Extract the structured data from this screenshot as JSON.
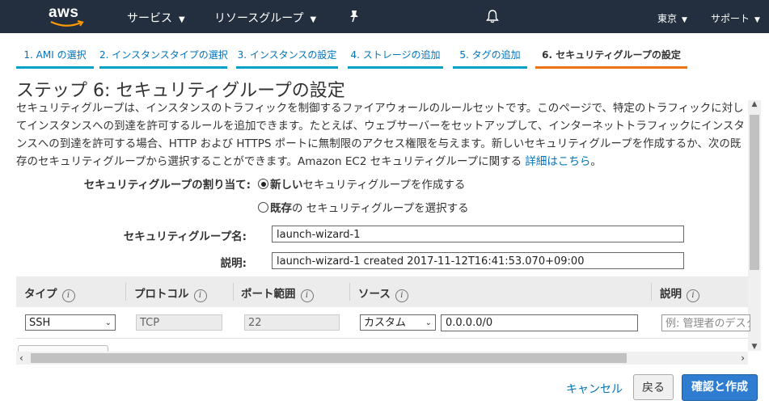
{
  "topbar": {
    "logo": "aws",
    "nav": [
      {
        "label": "サービス",
        "icon": "chevron-down-icon"
      },
      {
        "label": "リソースグループ",
        "icon": "chevron-down-icon"
      }
    ],
    "pin_icon": "pin-icon",
    "bell_icon": "bell-icon",
    "region": "東京",
    "support": "サポート",
    "background": "#232f3e"
  },
  "wizard_tabs": [
    {
      "label": "1. AMI の選択",
      "active": false
    },
    {
      "label": "2. インスタンスタイプの選択",
      "active": false
    },
    {
      "label": "3. インスタンスの設定",
      "active": false
    },
    {
      "label": "4. ストレージの追加",
      "active": false
    },
    {
      "label": "5. タグの追加",
      "active": false
    },
    {
      "label": "6. セキュリティグループの設定",
      "active": true
    }
  ],
  "page": {
    "title": "ステップ 6: セキュリティグループの設定",
    "description": "セキュリティグループは、インスタンスのトラフィックを制御するファイアウォールのルールセットです。このページで、特定のトラフィックに対してインスタンスへの到達を許可するルールを追加できます。たとえば、ウェブサーバーをセットアップして、インターネットトラフィックにインスタンスへの到達を許可する場合、HTTP および HTTPS ポートに無制限のアクセス権限を与えます。新しいセキュリティグループを作成するか、次の既存のセキュリティグループから選択することができます。Amazon EC2 セキュリティグループに関する",
    "details_link": "詳細はこちら",
    "description_end": "。"
  },
  "assignment": {
    "label": "セキュリティグループの割り当て:",
    "options": [
      {
        "bold": "新しい",
        "rest": "セキュリティグループを作成する",
        "checked": true
      },
      {
        "bold": "既存",
        "rest": "の セキュリティグループを選択する",
        "checked": false
      }
    ]
  },
  "group_name": {
    "label": "セキュリティグループ名:",
    "value": "launch-wizard-1"
  },
  "group_description": {
    "label": "説明:",
    "value": "launch-wizard-1 created 2017-11-12T16:41:53.070+09:00"
  },
  "rules_table": {
    "headers": [
      "タイプ",
      "プロトコル",
      "ポート範囲",
      "ソース",
      "説明"
    ],
    "info_icon": "info-icon",
    "rows": [
      {
        "type": "SSH",
        "protocol": "TCP",
        "port_range": "22",
        "source_type": "カスタム",
        "source_value": "0.0.0.0/0",
        "description_placeholder": "例: 管理者のデスクトップ"
      }
    ]
  },
  "footer": {
    "cancel": "キャンセル",
    "back": "戻る",
    "review_and_launch": "確認と作成",
    "primary_color": "#2e7dd1"
  }
}
